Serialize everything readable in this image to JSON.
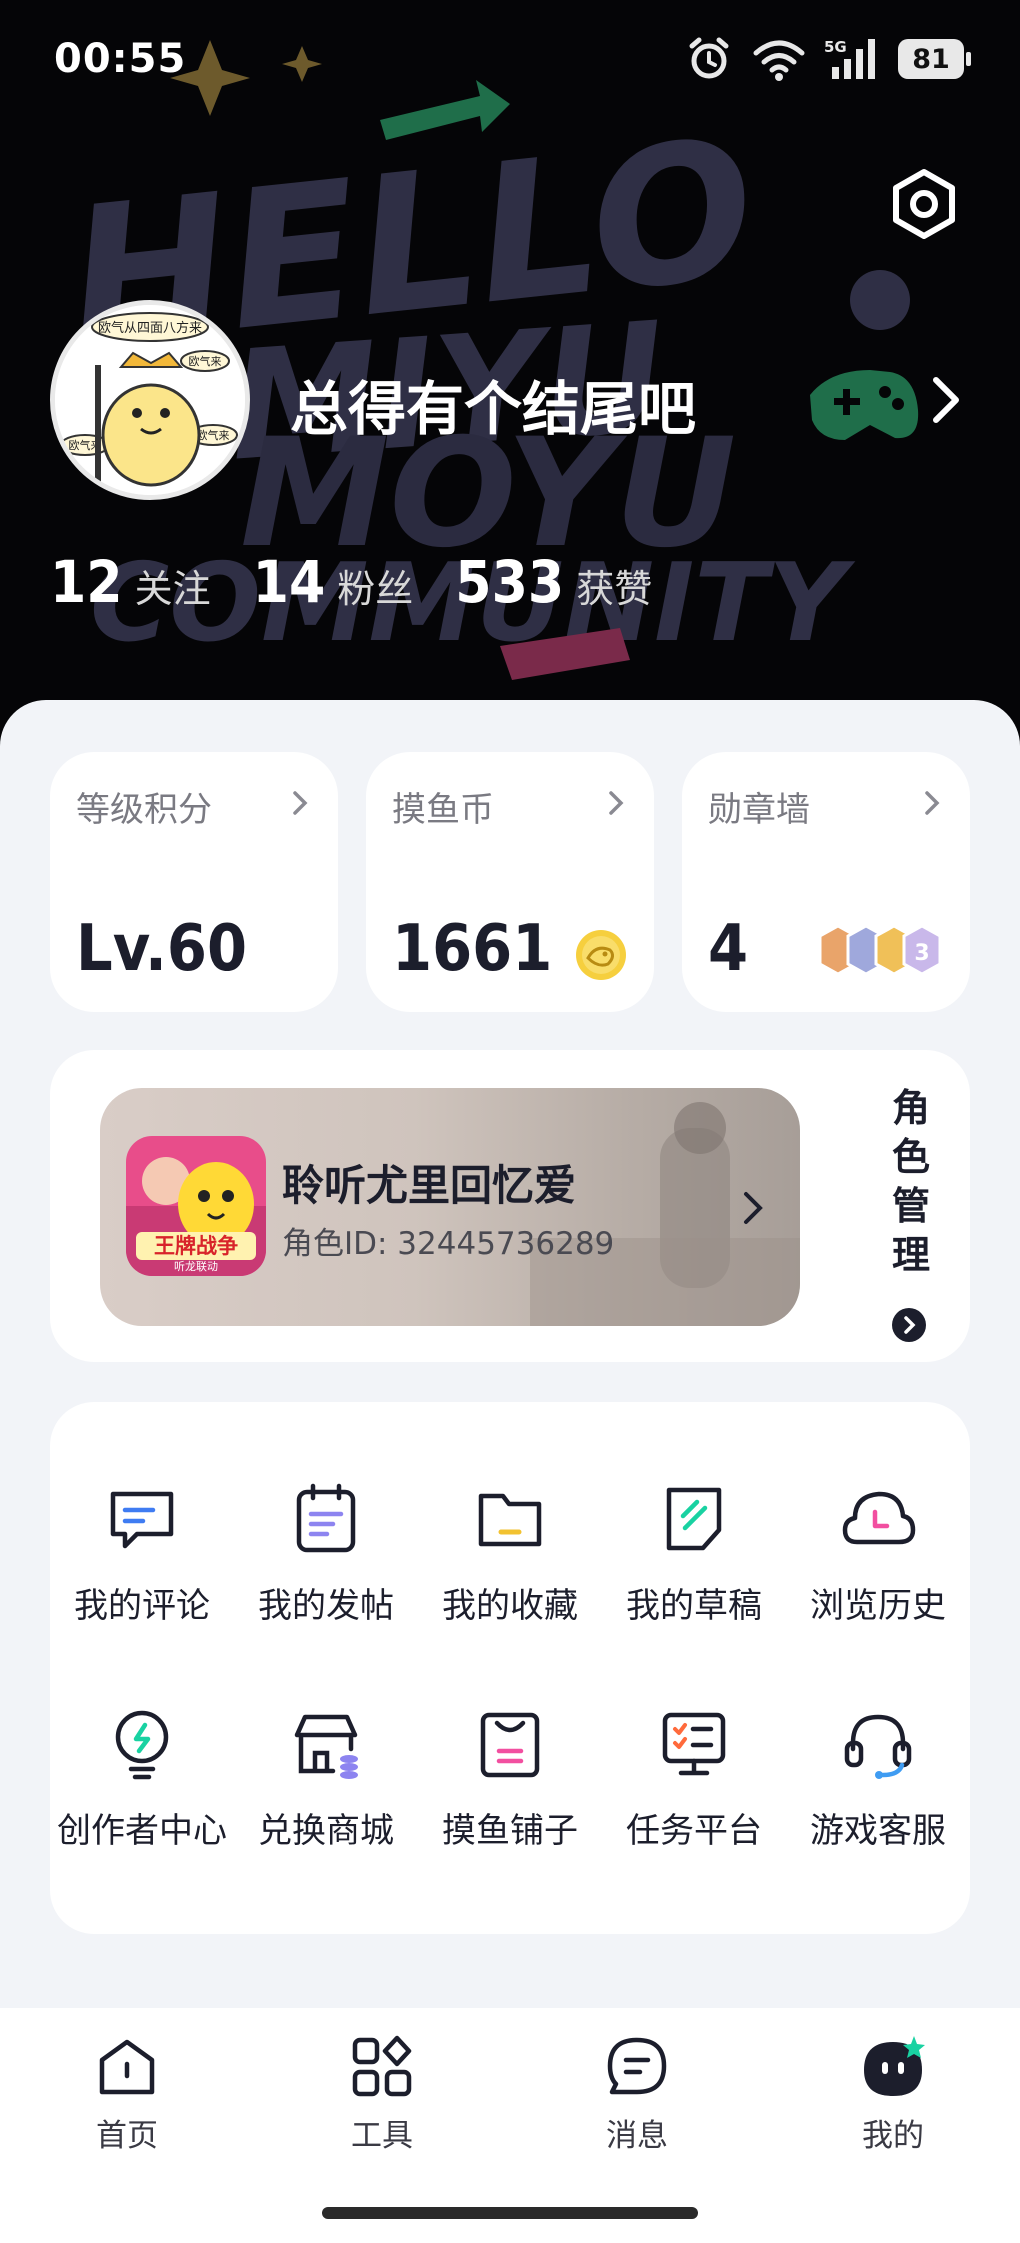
{
  "status_bar": {
    "time": "00:55",
    "battery": "81",
    "icons": [
      "alarm-icon",
      "wifi-icon",
      "5g-signal-icon",
      "battery-icon"
    ]
  },
  "profile": {
    "username": "总得有个结尾吧",
    "avatar_texts": [
      "欧气从四面八方来",
      "欧气来",
      "欧气来",
      "欧气来"
    ],
    "stats": [
      {
        "value": "12",
        "label": "关注"
      },
      {
        "value": "14",
        "label": "粉丝"
      },
      {
        "value": "533",
        "label": "获赞"
      }
    ],
    "background_text": [
      "HELLO",
      "MIYU",
      "MOYU",
      "COMMUNITY"
    ]
  },
  "summary_cards": [
    {
      "title": "等级积分",
      "value": "Lv.60"
    },
    {
      "title": "摸鱼币",
      "value": "1661"
    },
    {
      "title": "勋章墙",
      "value": "4"
    }
  ],
  "role": {
    "name": "聆听尤里回忆爱",
    "id_text": "角色ID: 32445736289",
    "game_icon_text": "王牌战争",
    "game_icon_subtext": "听龙联动",
    "manage_label": "角色管理"
  },
  "functions": [
    {
      "label": "我的评论",
      "icon": "comment-icon"
    },
    {
      "label": "我的发帖",
      "icon": "post-icon"
    },
    {
      "label": "我的收藏",
      "icon": "folder-icon"
    },
    {
      "label": "我的草稿",
      "icon": "draft-icon"
    },
    {
      "label": "浏览历史",
      "icon": "history-icon"
    },
    {
      "label": "创作者中心",
      "icon": "creator-icon"
    },
    {
      "label": "兑换商城",
      "icon": "shop-icon"
    },
    {
      "label": "摸鱼铺子",
      "icon": "store-bag-icon"
    },
    {
      "label": "任务平台",
      "icon": "task-icon"
    },
    {
      "label": "游戏客服",
      "icon": "headset-icon"
    }
  ],
  "bottom_nav": [
    {
      "label": "首页",
      "icon": "home-icon"
    },
    {
      "label": "工具",
      "icon": "tools-icon"
    },
    {
      "label": "消息",
      "icon": "message-icon"
    },
    {
      "label": "我的",
      "icon": "profile-icon"
    }
  ],
  "colors": {
    "header_bg": "#050507",
    "page_bg": "#f2f4f8",
    "text_dark": "#1c1e2c",
    "accent_blue": "#3f7cf2",
    "accent_yellow": "#f2c230",
    "accent_pink": "#f24fa0",
    "accent_green": "#19d2a2",
    "accent_purple": "#8d84f0"
  }
}
